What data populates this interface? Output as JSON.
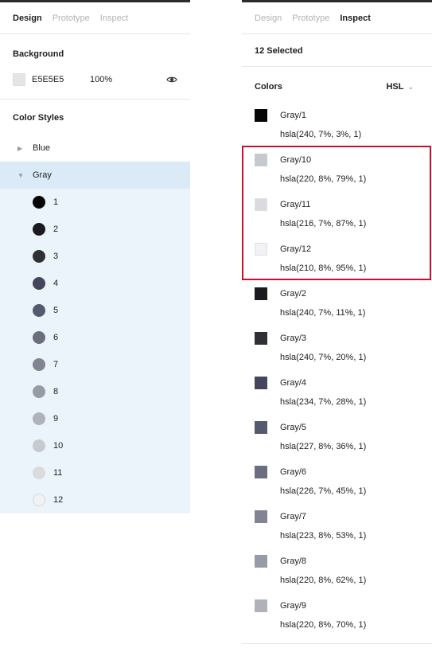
{
  "left": {
    "tabs": [
      "Design",
      "Prototype",
      "Inspect"
    ],
    "active_tab": "Design",
    "background": {
      "title": "Background",
      "hex": "E5E5E5",
      "opacity": "100%",
      "swatch_color": "#e5e5e5"
    },
    "color_styles": {
      "title": "Color Styles",
      "groups": [
        {
          "label": "Blue",
          "expanded": false
        },
        {
          "label": "Gray",
          "expanded": true
        }
      ],
      "gray_items": [
        {
          "label": "1",
          "color": "#070709"
        },
        {
          "label": "2",
          "color": "#1a1a1f"
        },
        {
          "label": "3",
          "color": "#303036"
        },
        {
          "label": "4",
          "color": "#45465d"
        },
        {
          "label": "5",
          "color": "#555a6e"
        },
        {
          "label": "6",
          "color": "#6b6e7f"
        },
        {
          "label": "7",
          "color": "#808493"
        },
        {
          "label": "8",
          "color": "#979ba5"
        },
        {
          "label": "9",
          "color": "#afb2b9"
        },
        {
          "label": "10",
          "color": "#c6c9cd"
        },
        {
          "label": "11",
          "color": "#dadbdf"
        },
        {
          "label": "12",
          "color": "#f0f2f4"
        }
      ]
    }
  },
  "right": {
    "tabs": [
      "Design",
      "Prototype",
      "Inspect"
    ],
    "active_tab": "Inspect",
    "selected_label": "12 Selected",
    "colors_title": "Colors",
    "format": "HSL",
    "colors": [
      {
        "name": "Gray/1",
        "value": "hsla(240, 7%, 3%, 1)",
        "color": "#070709"
      },
      {
        "name": "Gray/10",
        "value": "hsla(220, 8%, 79%, 1)",
        "color": "#c6c9cd"
      },
      {
        "name": "Gray/11",
        "value": "hsla(216, 7%, 87%, 1)",
        "color": "#dadbdf"
      },
      {
        "name": "Gray/12",
        "value": "hsla(210, 8%, 95%, 1)",
        "color": "#f0f2f4"
      },
      {
        "name": "Gray/2",
        "value": "hsla(240, 7%, 11%, 1)",
        "color": "#1a1a1f"
      },
      {
        "name": "Gray/3",
        "value": "hsla(240, 7%, 20%, 1)",
        "color": "#303036"
      },
      {
        "name": "Gray/4",
        "value": "hsla(234, 7%, 28%, 1)",
        "color": "#45465d"
      },
      {
        "name": "Gray/5",
        "value": "hsla(227, 8%, 36%, 1)",
        "color": "#555a6e"
      },
      {
        "name": "Gray/6",
        "value": "hsla(226, 7%, 45%, 1)",
        "color": "#6b6e7f"
      },
      {
        "name": "Gray/7",
        "value": "hsla(223, 8%, 53%, 1)",
        "color": "#808493"
      },
      {
        "name": "Gray/8",
        "value": "hsla(220, 8%, 62%, 1)",
        "color": "#979ba5"
      },
      {
        "name": "Gray/9",
        "value": "hsla(220, 8%, 70%, 1)",
        "color": "#afb2b9"
      }
    ],
    "highlight_color": "#c8102e"
  }
}
